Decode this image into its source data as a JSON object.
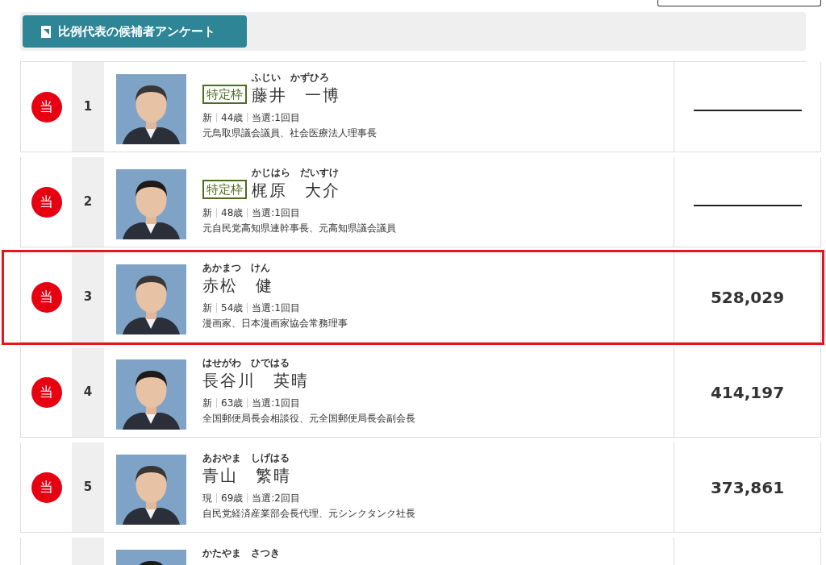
{
  "header": {
    "button": "比例代表の候補者アンケート"
  },
  "candidates": [
    {
      "kind": "full",
      "elected": true,
      "elected_label": "当",
      "rank": "1",
      "special_quota": true,
      "quota_label": "特定枠",
      "kana": "ふじい　かずひろ",
      "name": "藤井　一博",
      "status": "新",
      "age": "44歳",
      "terms": "当選:1回目",
      "career": "元鳥取県議会議員、社会医療法人理事長",
      "highlighted": false
    },
    {
      "kind": "full",
      "elected": true,
      "elected_label": "当",
      "rank": "2",
      "special_quota": true,
      "quota_label": "特定枠",
      "kana": "かじはら　だいすけ",
      "name": "梶原　大介",
      "status": "新",
      "age": "48歳",
      "terms": "当選:1回目",
      "career": "元自民党高知県連幹事長、元高知県議会議員",
      "highlighted": false
    },
    {
      "kind": "full",
      "elected": true,
      "elected_label": "当",
      "rank": "3",
      "special_quota": false,
      "kana": "あかまつ　けん",
      "name": "赤松　健",
      "status": "新",
      "age": "54歳",
      "terms": "当選:1回目",
      "career": "漫画家、日本漫画家協会常務理事",
      "votes": "528,029",
      "highlighted": true
    },
    {
      "kind": "full",
      "elected": true,
      "elected_label": "当",
      "rank": "4",
      "special_quota": false,
      "kana": "はせがわ　ひではる",
      "name": "長谷川　英晴",
      "status": "新",
      "age": "63歳",
      "terms": "当選:1回目",
      "career": "全国郵便局長会相談役、元全国郵便局長会副会長",
      "votes": "414,197",
      "highlighted": false
    },
    {
      "kind": "full",
      "elected": true,
      "elected_label": "当",
      "rank": "5",
      "special_quota": false,
      "kana": "あおやま　しげはる",
      "name": "青山　繁晴",
      "status": "現",
      "age": "69歳",
      "terms": "当選:2回目",
      "career": "自民党経済産業部会長代理、元シンクタンク社長",
      "votes": "373,861",
      "highlighted": false
    },
    {
      "kind": "partial",
      "kana": "かたやま　さつき"
    }
  ]
}
